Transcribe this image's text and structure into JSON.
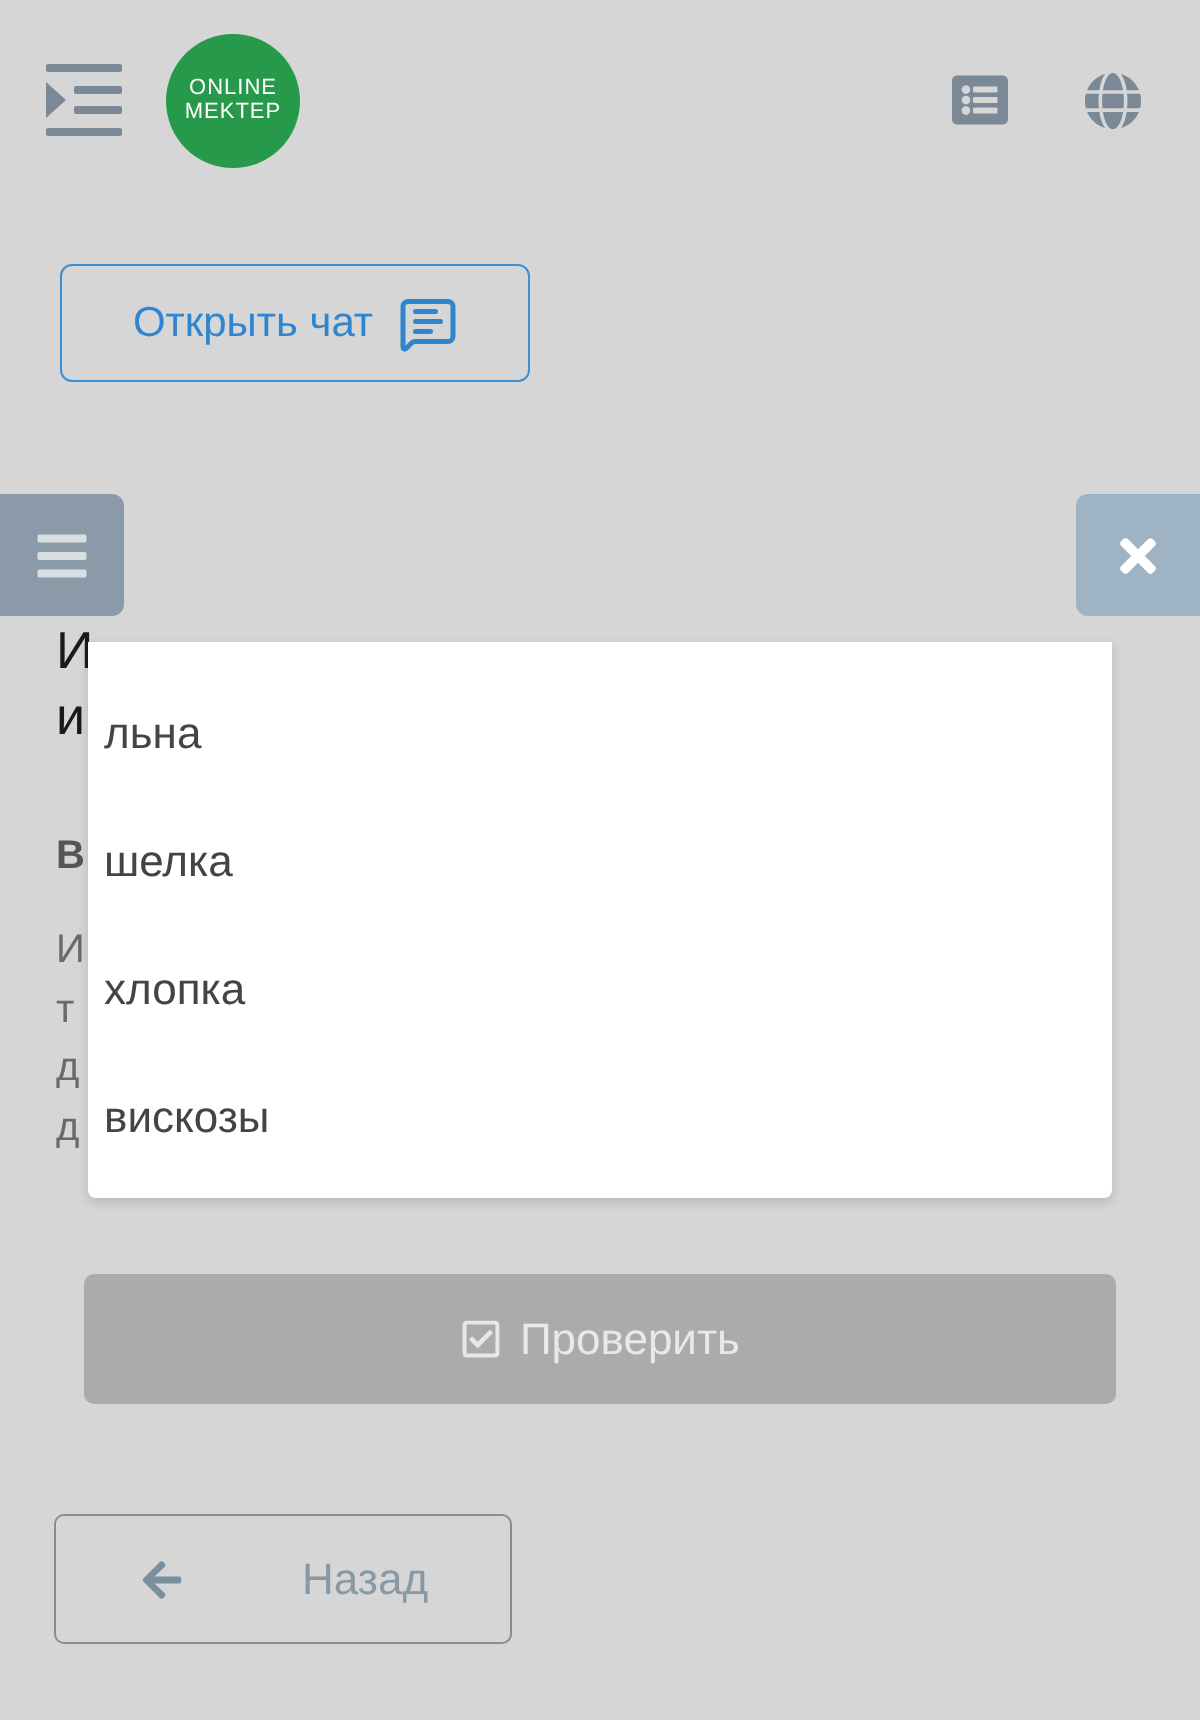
{
  "header": {
    "logo": {
      "lines": [
        "ONLINE",
        "MEKTEP"
      ]
    }
  },
  "chat_button": {
    "label": "Открыть чат"
  },
  "lesson": {
    "title_lines": [
      "И",
      "и"
    ],
    "section_heading": "В",
    "paragraph_lines": [
      "И",
      "т",
      "д",
      "д"
    ]
  },
  "dropdown": {
    "options": [
      {
        "label": "льна",
        "selected": false
      },
      {
        "label": "шелка",
        "selected": false
      },
      {
        "label": "хлопка",
        "selected": false
      },
      {
        "label": "вискозы",
        "selected": false
      }
    ]
  },
  "check_button": {
    "label": "Проверить",
    "disabled": true
  },
  "back_button": {
    "label": "Назад"
  }
}
